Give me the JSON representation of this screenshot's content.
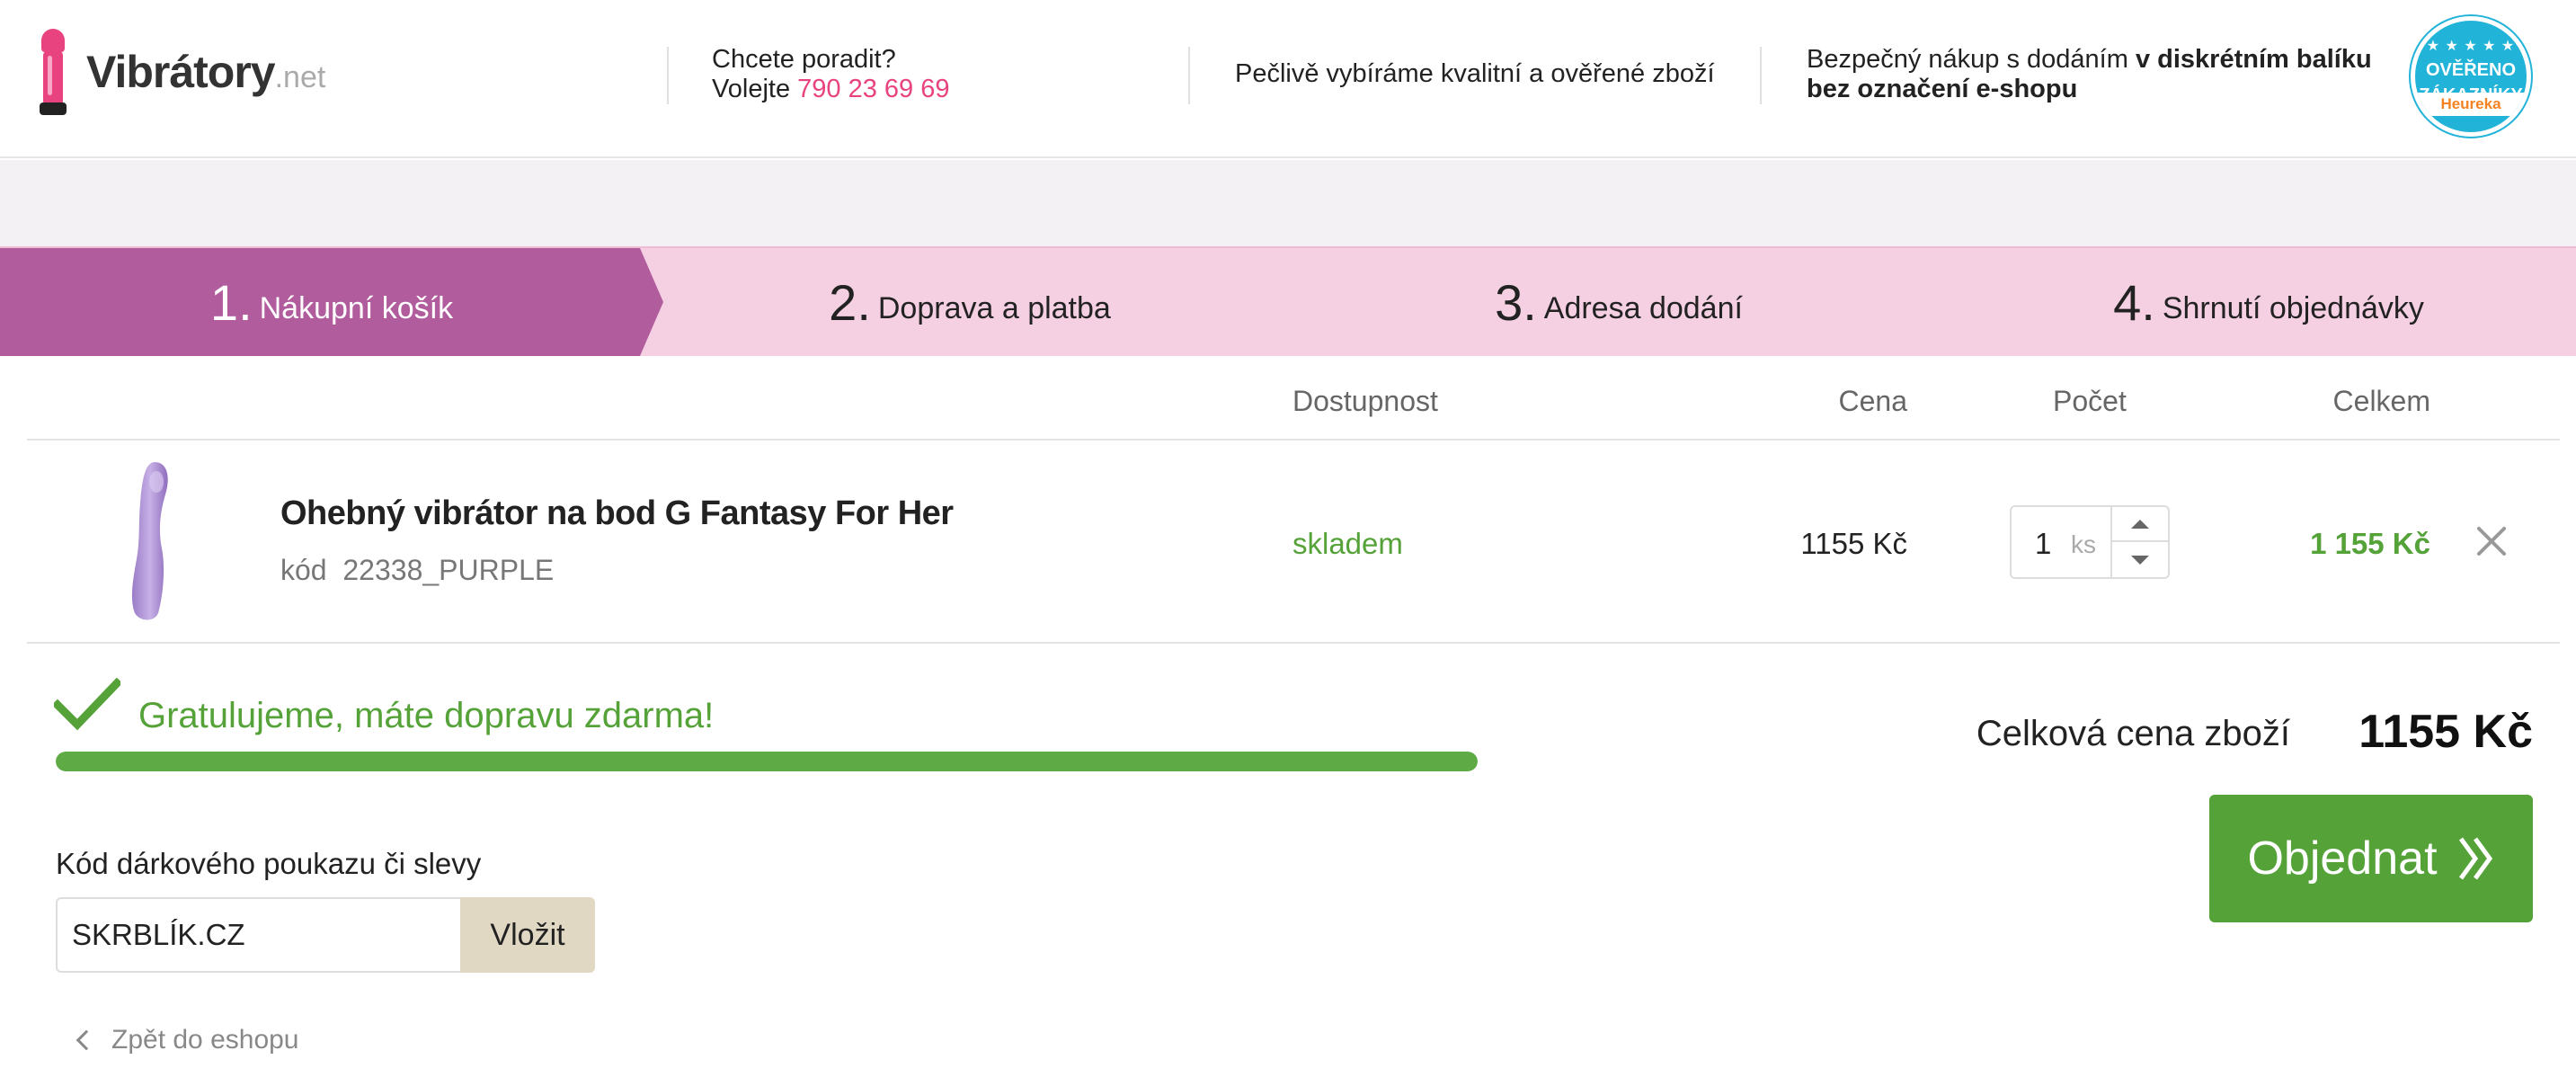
{
  "header": {
    "logo_main": "Vibrátory",
    "logo_suffix": ".net",
    "help_line1": "Chcete poradit?",
    "help_line2_prefix": "Volejte",
    "phone": "790 23 69 69",
    "quality_text": "Pečlivě vybíráme kvalitní a ověřené zboží",
    "secure_prefix": "Bezpečný nákup s dodáním",
    "secure_bold1": "v diskrétním balíku",
    "secure_bold2": "bez označení e-shopu",
    "badge_line1": "OVĚŘENO",
    "badge_line2": "ZÁKAZNÍKY",
    "badge_brand": "Heureka"
  },
  "steps": [
    {
      "num": "1.",
      "label": "Nákupní košík",
      "active": true
    },
    {
      "num": "2.",
      "label": "Doprava a platba",
      "active": false
    },
    {
      "num": "3.",
      "label": "Adresa dodání",
      "active": false
    },
    {
      "num": "4.",
      "label": "Shrnutí objednávky",
      "active": false
    }
  ],
  "table": {
    "col_availability": "Dostupnost",
    "col_price": "Cena",
    "col_quantity": "Počet",
    "col_total": "Celkem"
  },
  "item": {
    "name": "Ohebný vibrátor na bod G Fantasy For Her",
    "code_label": "kód",
    "code": "22338_PURPLE",
    "availability": "skladem",
    "price": "1155 Kč",
    "quantity": "1",
    "unit": "ks",
    "total": "1 155 Kč"
  },
  "shipping": {
    "message": "Gratulujeme, máte dopravu zdarma!",
    "progress_fraction": 1.0
  },
  "coupon": {
    "label": "Kód dárkového poukazu či slevy",
    "value": "SKRBLÍK.CZ",
    "button": "Vložit"
  },
  "back_link": "Zpět do eshopu",
  "summary": {
    "label": "Celková cena zboží",
    "value": "1155 Kč",
    "order_button": "Objednat"
  },
  "colors": {
    "brand_pink": "#e8437e",
    "step_active": "#b15c9d",
    "step_bg": "#f5d0e3",
    "green": "#55a239",
    "coupon_button": "#e0d8c3"
  }
}
